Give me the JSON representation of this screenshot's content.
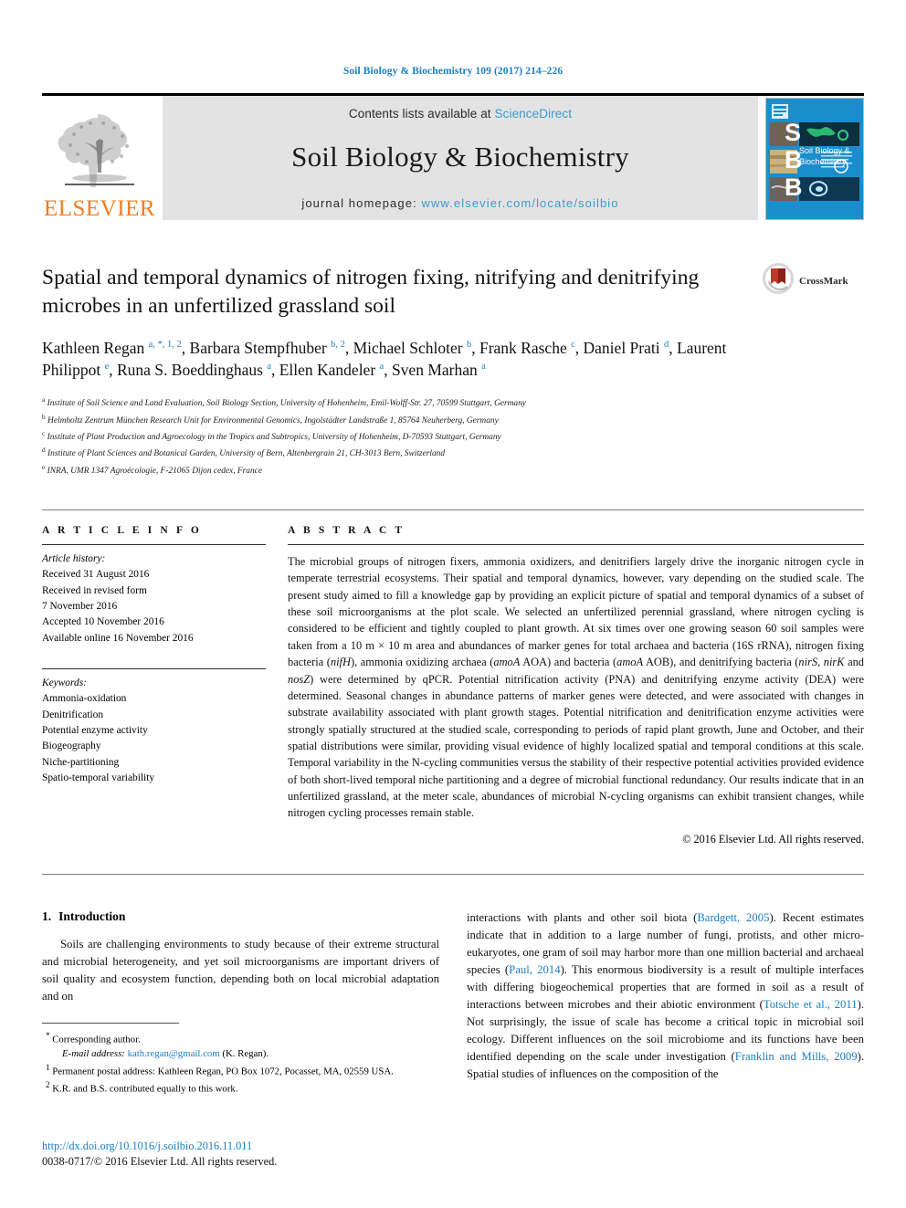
{
  "running_head": "Soil Biology & Biochemistry 109 (2017) 214–226",
  "publisher": {
    "logo_word": "ELSEVIER",
    "tree_icon": "elsevier-tree-icon"
  },
  "banner": {
    "contents_prefix": "Contents lists available at",
    "sciencedirect": "ScienceDirect",
    "journal_title": "Soil Biology & Biochemistry",
    "homepage_prefix": "journal homepage:",
    "homepage_url": "www.elsevier.com/locate/soilbio"
  },
  "cover": {
    "letters": [
      "S",
      "B",
      "B"
    ],
    "caption_line1": "Soil Biology &",
    "caption_line2": "Biochemistry"
  },
  "article": {
    "title": "Spatial and temporal dynamics of nitrogen fixing, nitrifying and denitrifying microbes in an unfertilized grassland soil",
    "authors_html": "Kathleen Regan <sup>a, *, 1, 2</sup>, Barbara Stempfhuber <sup>b, 2</sup>, Michael Schloter <sup>b</sup>, Frank Rasche <sup>c</sup>, Daniel Prati <sup>d</sup>, Laurent Philippot <sup>e</sup>, Runa S. Boeddinghaus <sup>a</sup>, Ellen Kandeler <sup>a</sup>, Sven Marhan <sup>a</sup>",
    "affiliations": [
      {
        "mark": "a",
        "text": "Institute of Soil Science and Land Evaluation, Soil Biology Section, University of Hohenheim, Emil-Wolff-Str. 27, 70599 Stuttgart, Germany"
      },
      {
        "mark": "b",
        "text": "Helmholtz Zentrum München Research Unit for Environmental Genomics, Ingolstädter Landstraße 1, 85764 Neuherberg, Germany"
      },
      {
        "mark": "c",
        "text": "Institute of Plant Production and Agroecology in the Tropics and Subtropics, University of Hohenheim, D-70593 Stuttgart, Germany"
      },
      {
        "mark": "d",
        "text": "Institute of Plant Sciences and Botanical Garden, University of Bern, Altenbergrain 21, CH-3013 Bern, Switzerland"
      },
      {
        "mark": "e",
        "text": "INRA, UMR 1347 Agroécologie, F-21065 Dijon cedex, France"
      }
    ],
    "crossmark_label": "CrossMark"
  },
  "article_info": {
    "heading": "A R T I C L E   I N F O",
    "history_label": "Article history:",
    "history": [
      "Received 31 August 2016",
      "Received in revised form",
      "7 November 2016",
      "Accepted 10 November 2016",
      "Available online 16 November 2016"
    ],
    "keywords_label": "Keywords:",
    "keywords": [
      "Ammonia-oxidation",
      "Denitrification",
      "Potential enzyme activity",
      "Biogeography",
      "Niche-partitioning",
      "Spatio-temporal variability"
    ]
  },
  "abstract": {
    "heading": "A B S T R A C T",
    "paragraph_html": "The microbial groups of nitrogen fixers, ammonia oxidizers, and denitrifiers largely drive the inorganic nitrogen cycle in temperate terrestrial ecosystems. Their spatial and temporal dynamics, however, vary depending on the studied scale. The present study aimed to fill a knowledge gap by providing an explicit picture of spatial and temporal dynamics of a subset of these soil microorganisms at the plot scale. We selected an unfertilized perennial grassland, where nitrogen cycling is considered to be efficient and tightly coupled to plant growth. At six times over one growing season 60 soil samples were taken from a 10 m × 10 m area and abundances of marker genes for total archaea and bacteria (16S rRNA), nitrogen fixing bacteria (<i>nifH</i>), ammonia oxidizing archaea (<i>amoA</i> AOA) and bacteria (<i>amoA</i> AOB), and denitrifying bacteria (<i>nirS</i>, <i>nirK</i> and <i>nosZ</i>) were determined by qPCR. Potential nitrification activity (PNA) and denitrifying enzyme activity (DEA) were determined. Seasonal changes in abundance patterns of marker genes were detected, and were associated with changes in substrate availability associated with plant growth stages. Potential nitrification and denitrification enzyme activities were strongly spatially structured at the studied scale, corresponding to periods of rapid plant growth, June and October, and their spatial distributions were similar, providing visual evidence of highly localized spatial and temporal conditions at this scale. Temporal variability in the N-cycling communities versus the stability of their respective potential activities provided evidence of both short-lived temporal niche partitioning and a degree of microbial functional redundancy. Our results indicate that in an unfertilized grassland, at the meter scale, abundances of microbial N-cycling organisms can exhibit transient changes, while nitrogen cycling processes remain stable.",
    "copyright": "© 2016 Elsevier Ltd. All rights reserved."
  },
  "introduction": {
    "number": "1.",
    "heading": "Introduction",
    "left_paragraph": "Soils are challenging environments to study because of their extreme structural and microbial heterogeneity, and yet soil microorganisms are important drivers of soil quality and ecosystem function, depending both on local microbial adaptation and on",
    "right_paragraph_html": "interactions with plants and other soil biota (<span class=\"ref\">Bardgett, 2005</span>). Recent estimates indicate that in addition to a large number of fungi, protists, and other micro-eukaryotes, one gram of soil may harbor more than one million bacterial and archaeal species (<span class=\"ref\">Paul, 2014</span>). This enormous biodiversity is a result of multiple interfaces with differing biogeochemical properties that are formed in soil as a result of interactions between microbes and their abiotic environment (<span class=\"ref\">Totsche et al., 2011</span>). Not surprisingly, the issue of scale has become a critical topic in microbial soil ecology. Different influences on the soil microbiome and its functions have been identified depending on the scale under investigation (<span class=\"ref\">Franklin and Mills, 2009</span>). Spatial studies of influences on the composition of the"
  },
  "footnotes": [
    {
      "mark": "*",
      "html": "Corresponding author."
    },
    {
      "mark": "",
      "html": "<span class=\"em\">E-mail address:</span> <span class=\"link\">kath.regan@gmail.com</span> (K. Regan)."
    },
    {
      "mark": "1",
      "html": "Permanent postal address: Kathleen Regan, PO Box 1072, Pocasset, MA, 02559 USA."
    },
    {
      "mark": "2",
      "html": "K.R. and B.S. contributed equally to this work."
    }
  ],
  "bottom": {
    "doi": "http://dx.doi.org/10.1016/j.soilbio.2016.11.011",
    "issn_line": "0038-0717/© 2016 Elsevier Ltd. All rights reserved."
  },
  "colors": {
    "link_blue": "#1a7fc1",
    "sciencedirect_blue": "#3a9bd0",
    "elsevier_orange": "#f47c20",
    "banner_grey": "#e3e3e3",
    "cover_blue": "#1a8ecd",
    "crossmark_red": "#c3362b"
  }
}
